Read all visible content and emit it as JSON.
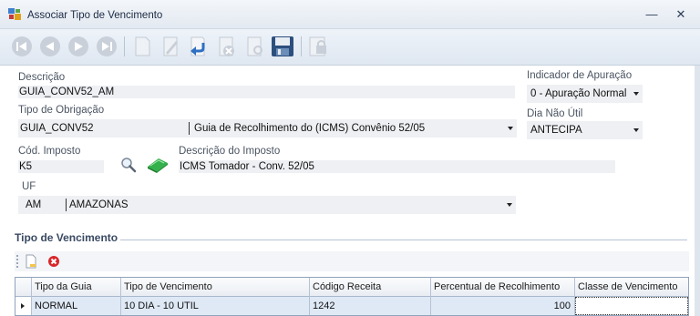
{
  "window": {
    "title": "Associar Tipo de Vencimento",
    "minimize_glyph": "―",
    "close_glyph": "✕"
  },
  "toolbar": {
    "buttons": [
      {
        "icon": "first-record-icon"
      },
      {
        "icon": "previous-record-icon"
      },
      {
        "icon": "next-record-icon"
      },
      {
        "icon": "last-record-icon"
      },
      {
        "icon": "new-document-icon"
      },
      {
        "icon": "edit-pencil-icon"
      },
      {
        "icon": "undo-arrow-icon"
      },
      {
        "icon": "delete-icon"
      },
      {
        "icon": "search-document-icon"
      },
      {
        "icon": "save-floppy-icon"
      },
      {
        "icon": "lock-icon"
      }
    ]
  },
  "form": {
    "descricao": {
      "label": "Descrição",
      "value": "GUIA_CONV52_AM"
    },
    "tipo_obrigacao": {
      "label": "Tipo de Obrigação",
      "code": "GUIA_CONV52",
      "description": "Guia de Recolhimento do (ICMS) Convênio 52/05"
    },
    "cod_imposto": {
      "label": "Cód. Imposto",
      "value": "K5"
    },
    "descricao_imposto": {
      "label": "Descrição do Imposto",
      "value": "ICMS Tomador - Conv. 52/05"
    },
    "uf": {
      "label": "UF",
      "code": "AM",
      "name": "AMAZONAS"
    },
    "indicador_apuracao": {
      "label": "Indicador de Apuração",
      "value": "0 - Apuração Normal"
    },
    "dia_nao_util": {
      "label": "Dia Não Útil",
      "value": "ANTECIPA"
    }
  },
  "section": {
    "title": "Tipo de Vencimento"
  },
  "grid": {
    "columns": [
      "Tipo da Guia",
      "Tipo de Vencimento",
      "Código Receita",
      "Percentual de Recolhimento",
      "Classe de Vencimento"
    ],
    "rows": [
      {
        "tipo_guia": "NORMAL",
        "tipo_vencimento": "10 DIA - 10 UTIL",
        "codigo_receita": "1242",
        "percentual": "100",
        "classe": ""
      }
    ]
  },
  "colors": {
    "accent": "#3b78c4",
    "delete": "#d9262b",
    "eraser": "#33b14a"
  }
}
